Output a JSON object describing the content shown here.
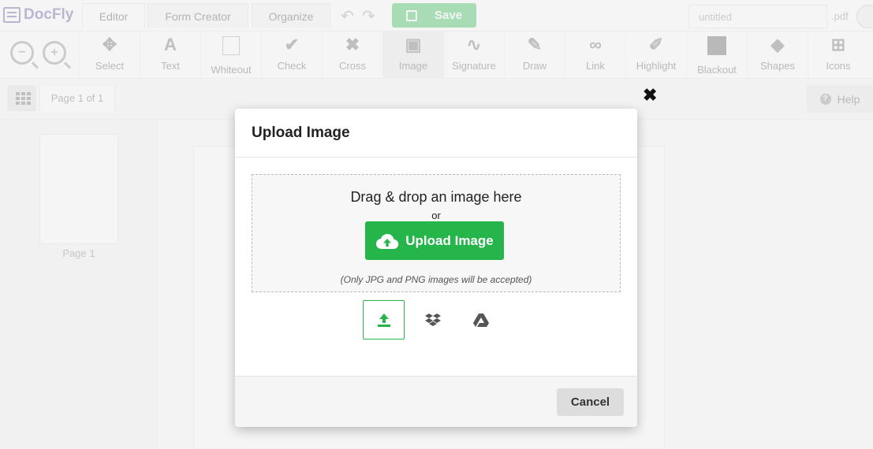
{
  "app": {
    "logo_text": "DocFly",
    "tabs": [
      {
        "label": "Editor"
      },
      {
        "label": "Form Creator"
      },
      {
        "label": "Organize"
      }
    ],
    "save_label": "Save",
    "filename_placeholder": "untitled",
    "file_extension": ".pdf"
  },
  "toolbar": {
    "tools": [
      {
        "label": "Select"
      },
      {
        "label": "Text"
      },
      {
        "label": "Whiteout"
      },
      {
        "label": "Check"
      },
      {
        "label": "Cross"
      },
      {
        "label": "Image"
      },
      {
        "label": "Signature"
      },
      {
        "label": "Draw"
      },
      {
        "label": "Link"
      },
      {
        "label": "Highlight"
      },
      {
        "label": "Blackout"
      },
      {
        "label": "Shapes"
      },
      {
        "label": "Icons"
      }
    ]
  },
  "secondbar": {
    "page_indicator": "Page 1 of 1",
    "help_label": "Help"
  },
  "thumbnails": [
    {
      "label": "Page 1"
    }
  ],
  "modal": {
    "title": "Upload Image",
    "drop_text": "Drag & drop an image here",
    "or_text": "or",
    "upload_button": "Upload Image",
    "note": "(Only JPG and PNG images will be accepted)",
    "sources": [
      "upload-icon",
      "dropbox-icon",
      "google-drive-icon"
    ],
    "cancel_label": "Cancel"
  },
  "colors": {
    "accent_green": "#25b54b",
    "brand_purple": "#5b4a99"
  }
}
